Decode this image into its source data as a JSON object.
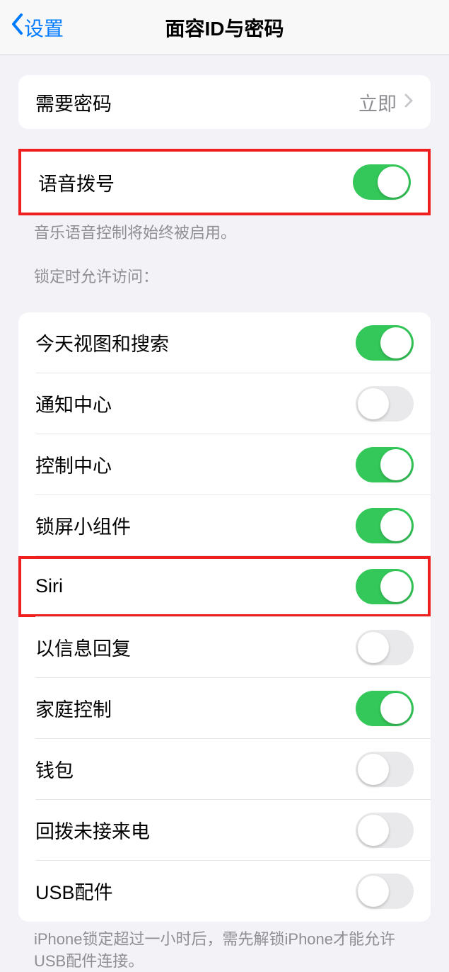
{
  "nav": {
    "back_label": "设置",
    "title": "面容ID与密码"
  },
  "require_passcode": {
    "label": "需要密码",
    "value": "立即"
  },
  "voice_dial": {
    "label": "语音拨号",
    "on": true,
    "footer": "音乐语音控制将始终被启用。"
  },
  "lock_access": {
    "header": "锁定时允许访问：",
    "items": [
      {
        "label": "今天视图和搜索",
        "on": true
      },
      {
        "label": "通知中心",
        "on": false
      },
      {
        "label": "控制中心",
        "on": true
      },
      {
        "label": "锁屏小组件",
        "on": true
      },
      {
        "label": "Siri",
        "on": true,
        "highlighted": true
      },
      {
        "label": "以信息回复",
        "on": false
      },
      {
        "label": "家庭控制",
        "on": true
      },
      {
        "label": "钱包",
        "on": false
      },
      {
        "label": "回拨未接来电",
        "on": false
      },
      {
        "label": "USB配件",
        "on": false
      }
    ],
    "footer": "iPhone锁定超过一小时后，需先解锁iPhone才能允许USB配件连接。"
  }
}
